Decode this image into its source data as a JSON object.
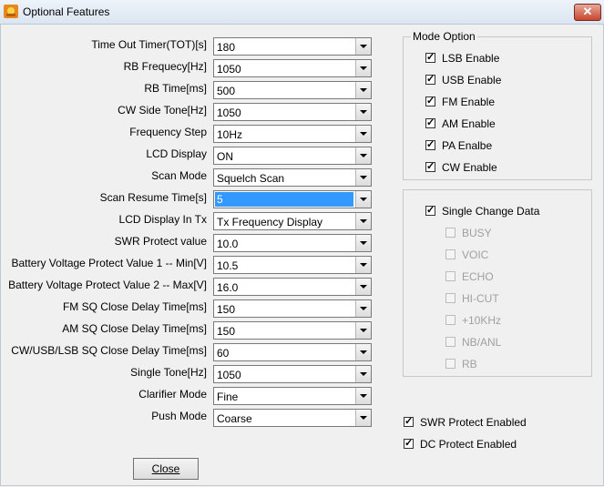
{
  "window": {
    "title": "Optional Features",
    "close_glyph": "✕",
    "icon": "app-icon"
  },
  "fields": [
    {
      "label": "Time Out Timer(TOT)[s]",
      "value": "180"
    },
    {
      "label": "RB Frequecy[Hz]",
      "value": "1050"
    },
    {
      "label": "RB Time[ms]",
      "value": "500"
    },
    {
      "label": "CW Side Tone[Hz]",
      "value": "1050"
    },
    {
      "label": "Frequency Step",
      "value": "10Hz"
    },
    {
      "label": "LCD Display",
      "value": "ON"
    },
    {
      "label": "Scan Mode",
      "value": "Squelch Scan"
    },
    {
      "label": "Scan Resume Time[s]",
      "value": "5"
    },
    {
      "label": "LCD Display In Tx",
      "value": "Tx Frequency Display"
    },
    {
      "label": "SWR Protect value",
      "value": "10.0"
    },
    {
      "label": "Battery Voltage Protect Value 1 -- Min[V]",
      "value": "10.5"
    },
    {
      "label": "Battery Voltage Protect Value 2 -- Max[V]",
      "value": "16.0"
    },
    {
      "label": "FM SQ Close Delay Time[ms]",
      "value": "150"
    },
    {
      "label": "AM SQ Close Delay Time[ms]",
      "value": "150"
    },
    {
      "label": "CW/USB/LSB SQ Close Delay Time[ms]",
      "value": "60"
    },
    {
      "label": "Single Tone[Hz]",
      "value": "1050"
    },
    {
      "label": "Clarifier Mode",
      "value": "Fine"
    },
    {
      "label": "Push Mode",
      "value": "Coarse"
    }
  ],
  "mode_option": {
    "title": "Mode Option",
    "items": [
      {
        "label": "LSB Enable",
        "checked": true
      },
      {
        "label": "USB Enable",
        "checked": true
      },
      {
        "label": "FM Enable",
        "checked": true
      },
      {
        "label": "AM Enable",
        "checked": true
      },
      {
        "label": "PA Enalbe",
        "checked": true
      },
      {
        "label": "CW Enable",
        "checked": true
      }
    ]
  },
  "single_change": {
    "label": "Single Change Data",
    "checked": true,
    "items": [
      {
        "label": "BUSY",
        "checked": false
      },
      {
        "label": "VOIC",
        "checked": false
      },
      {
        "label": "ECHO",
        "checked": false
      },
      {
        "label": "HI-CUT",
        "checked": false
      },
      {
        "label": "+10KHz",
        "checked": false
      },
      {
        "label": "NB/ANL",
        "checked": false
      },
      {
        "label": "RB",
        "checked": false
      }
    ]
  },
  "protect": [
    {
      "label": "SWR Protect Enabled",
      "checked": true
    },
    {
      "label": "DC Protect Enabled",
      "checked": true
    }
  ],
  "close_button": {
    "label": "Close"
  },
  "checkmark": "✓"
}
